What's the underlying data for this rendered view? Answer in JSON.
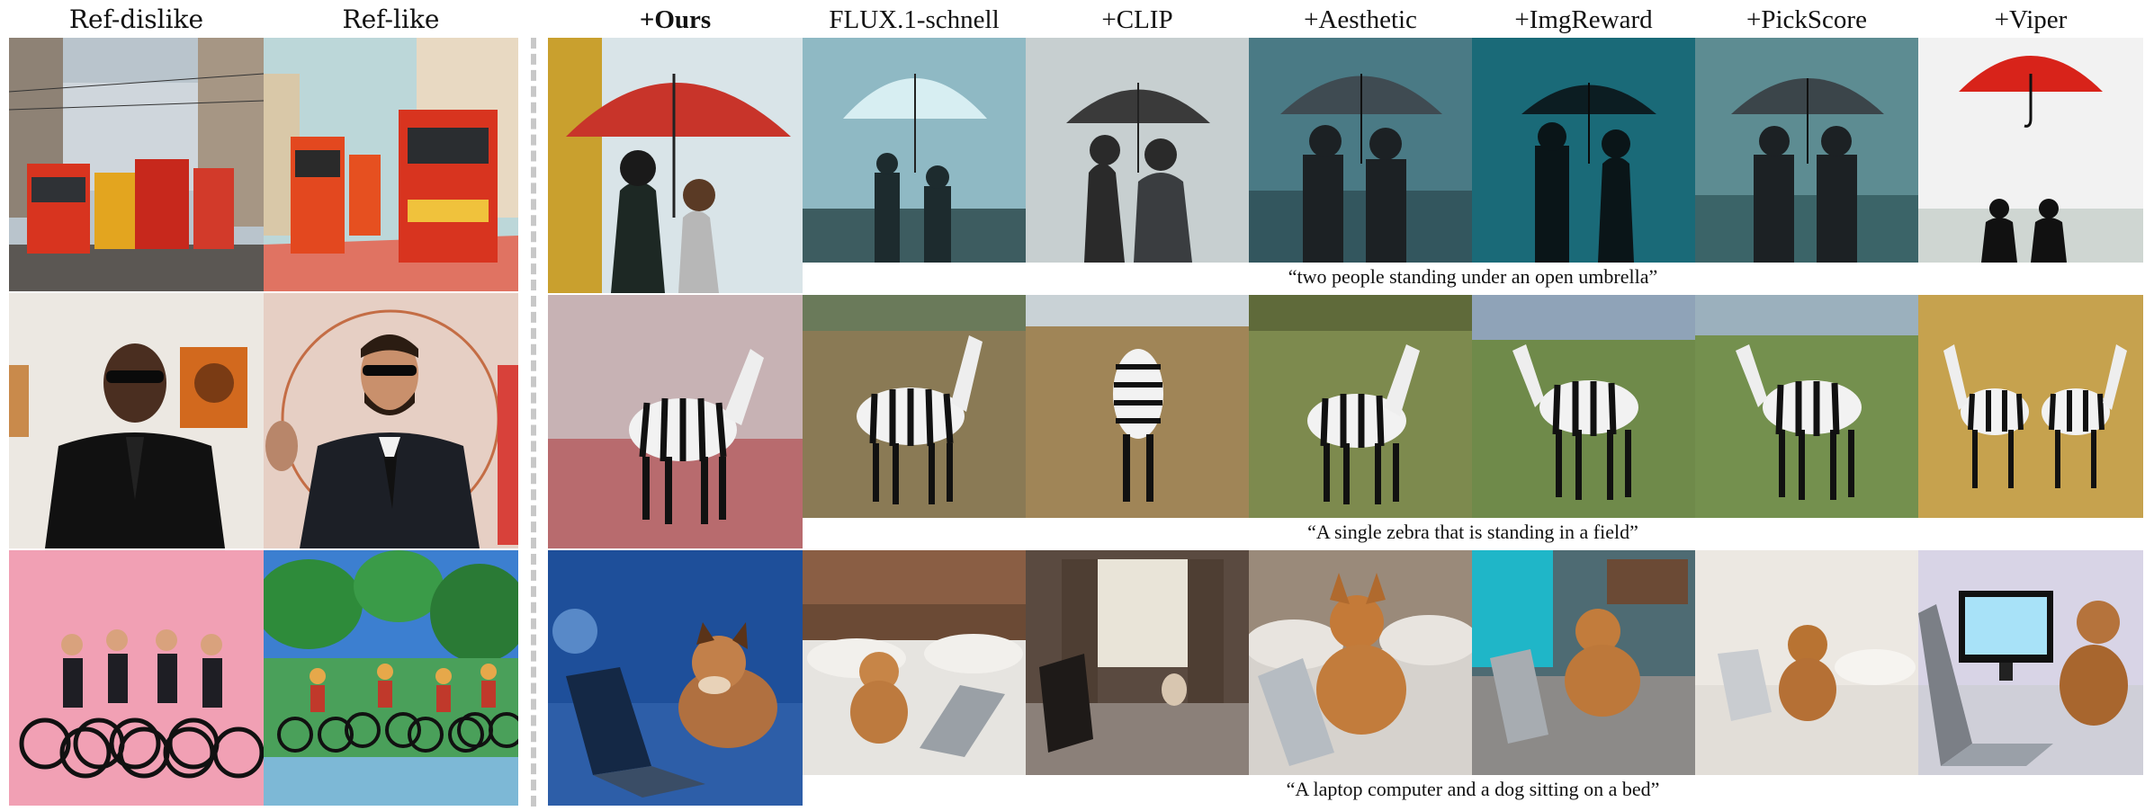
{
  "headers": {
    "ref_dislike": "Ref-dislike",
    "ref_like": "Ref-like",
    "ours": "+Ours",
    "flux": "FLUX.1-schnell",
    "clip": "+CLIP",
    "aesthetic": "+Aesthetic",
    "imgreward": "+ImgReward",
    "pickscore": "+PickScore",
    "viper": "+Viper"
  },
  "captions": {
    "row1": "“two people standing under an open umbrella”",
    "row2": "“A single zebra that is standing in a field”",
    "row3": "“A laptop computer and a dog sitting on a bed”"
  },
  "colors": {
    "separator": "#c8c8c8",
    "umbrella_red": "#c8342a",
    "tram_red": "#d8341f",
    "dislike_pink": "#f1a0b4",
    "bed_blue": "#2d5ea8"
  },
  "image_subjects": {
    "ref_row1": "trams-on-street",
    "ref_row2": "man-in-suit-sunglasses",
    "ref_row3": "cyclists-painting",
    "row1": "couple-under-umbrella",
    "row2": "zebra-in-field",
    "row3": "dog-with-laptop-on-bed"
  }
}
